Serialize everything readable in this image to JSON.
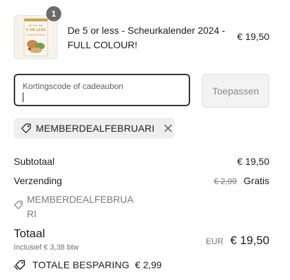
{
  "product": {
    "quantity": "1",
    "title": "De 5 or less - Scheurkalender 2024 - FULL COLOUR!",
    "price": "€ 19,50",
    "thumb_lines": [
      "5 or less",
      "5 OR LESS"
    ]
  },
  "discount": {
    "placeholder": "Kortingscode of cadeaubon",
    "apply_label": "Toepassen",
    "applied_code": "MEMBERDEALFEBRUARI"
  },
  "summary": {
    "subtotal_label": "Subtotaal",
    "subtotal_value": "€ 19,50",
    "shipping_label": "Verzending",
    "shipping_old": "€ 2,99",
    "shipping_value": "Gratis",
    "discount_line": "MEMBERDEALFEBRUARI",
    "total_label": "Totaal",
    "tax_note": "Inclusief € 3,38 btw",
    "total_currency": "EUR",
    "total_value": "€ 19,50",
    "savings_label": "TOTALE BESPARING",
    "savings_value": "€ 2,99"
  },
  "colors": {
    "text": "#1c1c1c",
    "muted": "#7a7a7a",
    "badge": "#6b6b6b",
    "field_border": "#333333"
  }
}
